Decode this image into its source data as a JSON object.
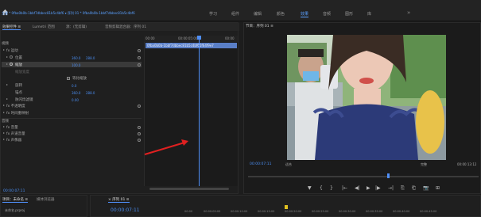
{
  "menu": {
    "workspaces": [
      "学习",
      "组件",
      "编辑",
      "颜色",
      "效果",
      "音频",
      "图形",
      "库"
    ],
    "active_workspace": "效果",
    "more": "»"
  },
  "effect_controls": {
    "tabs": [
      "效果控件 ≡",
      "Lumetri 范围",
      "源：(无剪辑)",
      "音频剪辑混合器：序列 01"
    ],
    "clip_path": "主要 * 0fba0b0b-1bbf7dbbec81b5c4bf6 ▾  序列 01 * 0fba0b0b-1bbf7dbbec81b5c4bf6",
    "ruler": [
      "00:00",
      "00:00:05:00",
      "00:00"
    ],
    "clip_name": "0fba0b0b-1bbf7dbbec81b5c4bf65f64f9e7",
    "section_video": "视频",
    "motion": "fx 运动",
    "position": "位置",
    "position_x": "360.0",
    "position_y": "288.0",
    "scale": "缩放",
    "scale_value": "100.0",
    "scale_width": "缩放宽度",
    "uniform_scale": "等比缩放",
    "rotation": "旋转",
    "rotation_value": "0.0",
    "anchor": "锚点",
    "anchor_x": "360.0",
    "anchor_y": "288.0",
    "anti_flicker": "防闪烁滤镜",
    "anti_flicker_value": "0.00",
    "opacity": "fx 不透明度",
    "time_remap": "fx 时间重映射",
    "section_audio": "音频",
    "volume": "fx 音量",
    "channel_volume": "fx 声道音量",
    "panner": "fx 声像器",
    "timecode": "00:00:07:11"
  },
  "program_monitor": {
    "title": "节目：序列 01 ≡",
    "timecode": "00:00:07:11",
    "fit": "适合",
    "quality": "完整",
    "duration": "00:00:13:12"
  },
  "transport": {
    "buttons": [
      "▼",
      "{",
      "}",
      "|←",
      "◀|",
      "▶",
      "|▶",
      "→|",
      "⎘",
      "⎗",
      "📷",
      "⊞"
    ]
  },
  "project": {
    "tabs": [
      "项目：未命名 ≡",
      "媒体浏览器"
    ],
    "item": "未命名.prproj"
  },
  "timeline": {
    "tab": "× 序列 01 ≡",
    "timecode": "00:00:07:11",
    "ticks": [
      "00:00",
      "00:00:05:00",
      "00:00:10:00",
      "00:00:15:00",
      "00:00:20:00",
      "00:00:25:00",
      "00:00:30:00",
      "00:00:35:00",
      "00:00:40:00",
      "00:00:45:00"
    ]
  },
  "colors": {
    "accent_blue": "#4f8ef7",
    "annotation_arrow": "#e02020"
  }
}
